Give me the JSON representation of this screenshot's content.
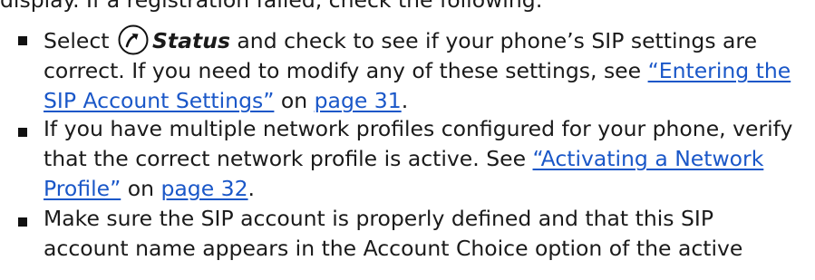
{
  "cut_off_line": "display. If a registration failed, check the following:",
  "items": [
    {
      "rows": [
        [
          "Select ",
          "{icon}",
          "{bold:Status}",
          " and check to see if your phone’s SIP settings are"
        ],
        [
          "correct. If you need to modify any of these settings, see ",
          "{link:“Entering the}"
        ],
        [
          "{link:SIP Account Settings”}",
          " on ",
          "{link:page 31}",
          "."
        ]
      ]
    },
    {
      "rows": [
        [
          "If you have multiple network profiles configured for your phone, verify"
        ],
        [
          "that the correct network profile is active. See ",
          "{link:“Activating a Network}"
        ],
        [
          "{link:Profile”}",
          " on ",
          "{link:page 32}",
          "."
        ]
      ]
    },
    {
      "rows": [
        [
          "Make sure the SIP account is properly defined and that this SIP"
        ],
        [
          "account name appears in the Account Choice option of the active"
        ]
      ]
    }
  ],
  "icon_name": "status-arrow-icon",
  "link_color": "#1a57c8"
}
